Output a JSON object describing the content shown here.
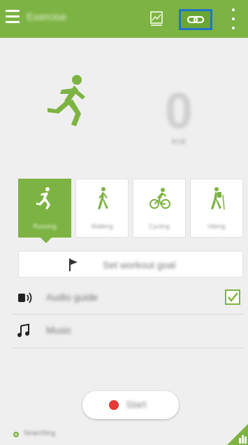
{
  "appbar": {
    "title": "Exercise",
    "icons": [
      "menu-icon",
      "chart-icon",
      "link-icon",
      "more-icon"
    ],
    "accent": "#7cb342",
    "highlight": "#1f74c9"
  },
  "counter": {
    "value": "0",
    "unit": "kcal"
  },
  "workouts": [
    {
      "label": "Running",
      "icon": "running-icon",
      "selected": true
    },
    {
      "label": "Walking",
      "icon": "walking-icon",
      "selected": false
    },
    {
      "label": "Cycling",
      "icon": "cycling-icon",
      "selected": false
    },
    {
      "label": "Hiking",
      "icon": "hiking-icon",
      "selected": false
    }
  ],
  "goal": {
    "label": "Set workout goal",
    "icon": "flag-icon"
  },
  "audio_guide": {
    "label": "Audio guide",
    "icon": "speaker-icon",
    "checked": true
  },
  "music": {
    "label": "Music",
    "icon": "music-note-icon"
  },
  "start": {
    "label": "Start",
    "icon": "record-icon",
    "color": "#e53935"
  },
  "status": {
    "text": "Searching",
    "icon": "gps-icon"
  }
}
